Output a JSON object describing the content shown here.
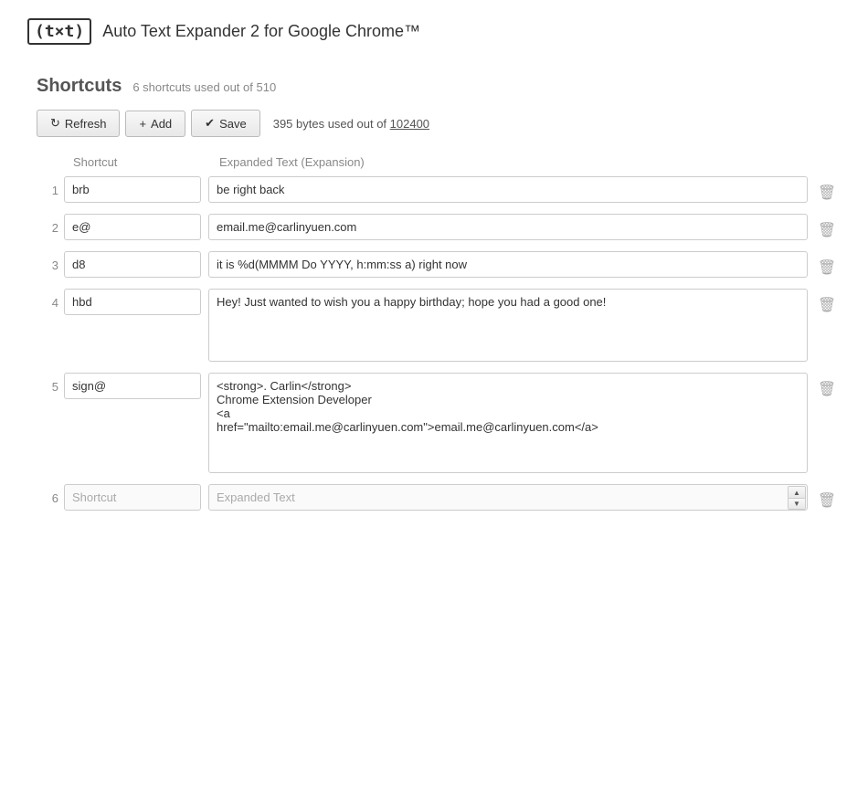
{
  "app": {
    "logo": "(t×t)",
    "title": "Auto Text Expander 2 for Google Chrome™"
  },
  "section": {
    "title": "Shortcuts",
    "subtitle": "6 shortcuts used out of 510"
  },
  "toolbar": {
    "refresh_label": "Refresh",
    "add_label": "Add",
    "save_label": "Save",
    "storage_info": "395 bytes used out of ",
    "storage_limit": "102400"
  },
  "columns": {
    "shortcut": "Shortcut",
    "expansion": "Expanded Text (Expansion)"
  },
  "rows": [
    {
      "number": "1",
      "shortcut": "brb",
      "expansion": "be right back",
      "multiline": false
    },
    {
      "number": "2",
      "shortcut": "e@",
      "expansion": "email.me@carlinyuen.com",
      "multiline": false
    },
    {
      "number": "3",
      "shortcut": "d8",
      "expansion": "it is %d(MMMM Do YYYY, h:mm:ss a) right now",
      "multiline": false
    },
    {
      "number": "4",
      "shortcut": "hbd",
      "expansion": "Hey! Just wanted to wish you a happy birthday; hope you had a good one!",
      "multiline": true
    },
    {
      "number": "5",
      "shortcut": "sign@",
      "expansion": "<strong>. Carlin</strong>\nChrome Extension Developer\n<a\nhref=\"mailto:email.me@carlinyuen.com\">email.me@carlinyuen.com</a>",
      "multiline": true,
      "tall": true
    },
    {
      "number": "6",
      "shortcut": "",
      "expansion": "",
      "multiline": false,
      "placeholder_shortcut": "Shortcut",
      "placeholder_expansion": "Expanded Text",
      "empty": true
    }
  ]
}
